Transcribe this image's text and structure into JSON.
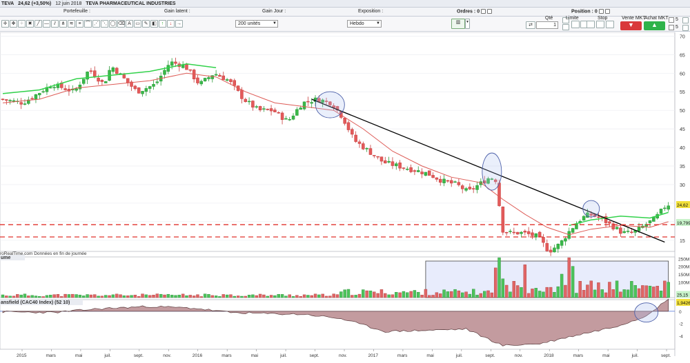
{
  "titlebar": {
    "ticker": "TEVA",
    "price": "24,62 (+3,50%)",
    "date": "12 juin 2018",
    "name": "TEVA PHARMACEUTICAL INDUSTRIES"
  },
  "header": {
    "portefeuille": "Portefeuille :",
    "gain_latent": "Gain latent :",
    "gain_jour": "Gain Jour :",
    "exposition": "Exposition :",
    "ordres": "Ordres :",
    "ordres_val": "0",
    "position": "Position :",
    "position_val": "0"
  },
  "toolbar": {
    "quantity_select": "200 unités",
    "period_select": "Hebdo",
    "qty_label": "Qté",
    "qty_value": "1",
    "limit_label": "Limite",
    "stop_label": "Stop",
    "sell_mkt": "Vente MKT",
    "buy_mkt": "Achat MKT",
    "chk1": "5",
    "chk2": "5"
  },
  "chart_data": {
    "type": "candlestick",
    "price_axis": {
      "ticks": [
        "70",
        "65",
        "60",
        "55",
        "50",
        "45",
        "40",
        "35",
        "30",
        "25",
        "20",
        "15"
      ],
      "range": [
        12,
        71
      ]
    },
    "volume_axis": {
      "ticks": [
        "250M",
        "200M",
        "150M",
        "100M"
      ],
      "range": [
        0,
        260
      ]
    },
    "indicator_axis": {
      "ticks": [
        "0",
        "-2",
        "-4"
      ],
      "range": [
        -6.2,
        1.9
      ]
    },
    "x_labels": [
      "2015",
      "mars",
      "mai",
      "juil.",
      "sept.",
      "nov.",
      "2016",
      "mars",
      "mai",
      "juil.",
      "sept.",
      "nov.",
      "2017",
      "mars",
      "mai",
      "juil.",
      "sept.",
      "nov.",
      "2018",
      "mars",
      "mai",
      "juil.",
      "sept."
    ],
    "last_price": "24,62",
    "ma_price": "19,799",
    "vol_last": "25,15",
    "indicator_last": "1,9426",
    "source_note": "roRealTime.com  Données en fin de journée",
    "volume_panel_label": "ume",
    "indicator_panel_label": "ansfield (CAC40 Index) (52 10)",
    "price_trend": [
      [
        0,
        53
      ],
      [
        6,
        52
      ],
      [
        14,
        57
      ],
      [
        20,
        55
      ],
      [
        24,
        61
      ],
      [
        28,
        57
      ],
      [
        30,
        62
      ],
      [
        34,
        58
      ],
      [
        37,
        55
      ],
      [
        42,
        57
      ],
      [
        46,
        63
      ],
      [
        50,
        62
      ],
      [
        54,
        57
      ],
      [
        58,
        60
      ],
      [
        62,
        58
      ],
      [
        66,
        53
      ],
      [
        70,
        50
      ],
      [
        74,
        50
      ],
      [
        78,
        47
      ],
      [
        82,
        52
      ],
      [
        86,
        53
      ],
      [
        90,
        52
      ],
      [
        93,
        48
      ],
      [
        96,
        42
      ],
      [
        100,
        39
      ],
      [
        104,
        36
      ],
      [
        108,
        35
      ],
      [
        112,
        34
      ],
      [
        116,
        33
      ],
      [
        120,
        31
      ],
      [
        124,
        30
      ],
      [
        127,
        28
      ],
      [
        130,
        30
      ],
      [
        133,
        32
      ],
      [
        135,
        31
      ],
      [
        136,
        18
      ],
      [
        138,
        17
      ],
      [
        142,
        17
      ],
      [
        146,
        16
      ],
      [
        149,
        12
      ],
      [
        152,
        14
      ],
      [
        155,
        18
      ],
      [
        158,
        21
      ],
      [
        160,
        22
      ],
      [
        163,
        21
      ],
      [
        166,
        19
      ],
      [
        169,
        17
      ],
      [
        172,
        17
      ],
      [
        175,
        19
      ],
      [
        178,
        21
      ],
      [
        181,
        24.6
      ]
    ],
    "ma_series": [
      [
        0,
        52
      ],
      [
        10,
        53
      ],
      [
        20,
        56
      ],
      [
        30,
        57
      ],
      [
        40,
        58
      ],
      [
        50,
        60
      ],
      [
        58,
        59
      ],
      [
        66,
        55
      ],
      [
        74,
        52
      ],
      [
        82,
        51
      ],
      [
        90,
        50
      ],
      [
        98,
        45
      ],
      [
        106,
        39
      ],
      [
        114,
        35
      ],
      [
        122,
        32
      ],
      [
        130,
        30.5
      ],
      [
        136,
        26
      ],
      [
        142,
        22
      ],
      [
        148,
        18.5
      ],
      [
        154,
        16.5
      ],
      [
        160,
        18
      ],
      [
        168,
        19
      ],
      [
        176,
        18.5
      ],
      [
        181,
        20
      ]
    ],
    "indicator_series": [
      [
        0,
        -0.1
      ],
      [
        14,
        -0.2
      ],
      [
        26,
        0.4
      ],
      [
        40,
        0.8
      ],
      [
        52,
        0.5
      ],
      [
        62,
        -0.2
      ],
      [
        72,
        -0.4
      ],
      [
        82,
        -0.5
      ],
      [
        92,
        -1.2
      ],
      [
        104,
        -3.3
      ],
      [
        116,
        -3.1
      ],
      [
        126,
        -2.9
      ],
      [
        136,
        -5.6
      ],
      [
        146,
        -5.3
      ],
      [
        156,
        -3.9
      ],
      [
        166,
        -2.6
      ],
      [
        174,
        -1.0
      ],
      [
        181,
        1.9
      ]
    ]
  }
}
